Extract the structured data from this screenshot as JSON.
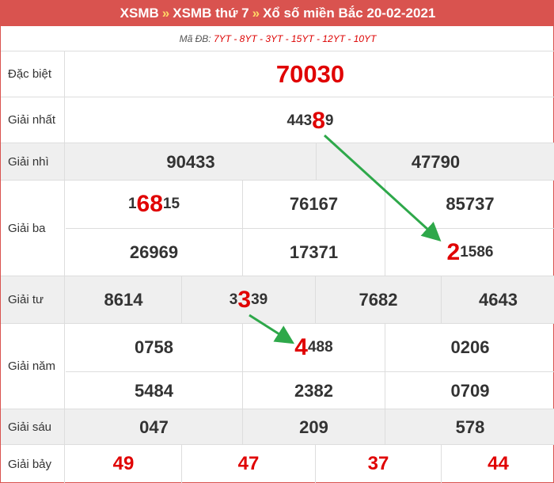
{
  "header": {
    "crumb1": "XSMB",
    "sep1": "»",
    "crumb2": "XSMB thứ 7",
    "sep2": "»",
    "crumb3": "Xổ số miền Bắc 20-02-2021"
  },
  "ma_db": {
    "label": "Mã ĐB:",
    "codes": "7YT - 8YT - 3YT - 15YT - 12YT - 10YT"
  },
  "prizes": {
    "db": {
      "label": "Đặc biệt",
      "value": "70030"
    },
    "g1": {
      "label": "Giải nhất",
      "pre": "443",
      "hl": "8",
      "post": "9"
    },
    "g2": {
      "label": "Giải nhì",
      "values": [
        "90433",
        "47790"
      ]
    },
    "g3": {
      "label": "Giải ba",
      "n1": {
        "pre": "1",
        "hl": "68",
        "post": "15"
      },
      "n2": "76167",
      "n3": "85737",
      "n4": "26969",
      "n5": "17371",
      "n6": {
        "pre": "",
        "hl": "2",
        "post": "1586"
      }
    },
    "g4": {
      "label": "Giải tư",
      "n1": "8614",
      "n2": {
        "pre": "3",
        "hl": "3",
        "post": "39"
      },
      "n3": "7682",
      "n4": "4643"
    },
    "g5": {
      "label": "Giải năm",
      "n1": "0758",
      "n2": {
        "pre": "",
        "hl": "4",
        "post": "488"
      },
      "n3": "0206",
      "n4": "5484",
      "n5": "2382",
      "n6": "0709"
    },
    "g6": {
      "label": "Giải sáu",
      "values": [
        "047",
        "209",
        "578"
      ]
    },
    "g7": {
      "label": "Giải bảy",
      "values": [
        "49",
        "47",
        "37",
        "44"
      ]
    }
  },
  "colors": {
    "header_bg": "#d9534f",
    "highlight": "#e00000",
    "arrow": "#2ea84a",
    "row_gray": "#efefef"
  }
}
